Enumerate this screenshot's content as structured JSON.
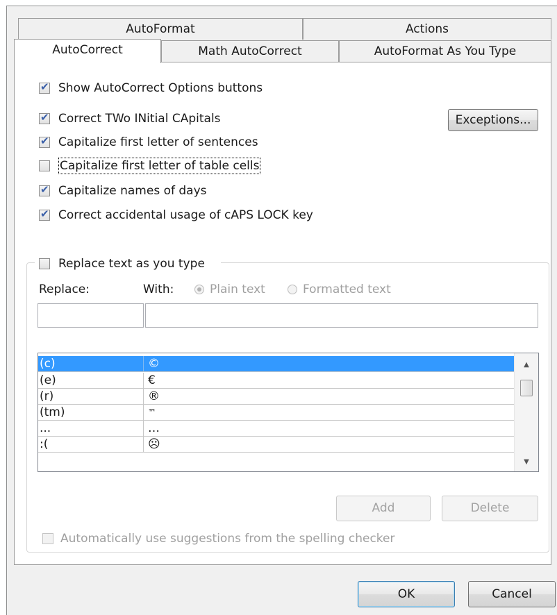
{
  "tabs_back": [
    "AutoFormat",
    "Actions"
  ],
  "tabs_front": [
    "AutoCorrect",
    "Math AutoCorrect",
    "AutoFormat As You Type"
  ],
  "options": {
    "show_buttons": {
      "label": "Show AutoCorrect Options buttons",
      "checked": true
    },
    "two_initial": {
      "label": "Correct TWo INitial CApitals",
      "checked": true
    },
    "first_letter_sentences": {
      "label": "Capitalize first letter of sentences",
      "checked": true
    },
    "first_letter_cells": {
      "label": "Capitalize first letter of table cells",
      "checked": false
    },
    "names_of_days": {
      "label": "Capitalize names of days",
      "checked": true
    },
    "caps_lock": {
      "label": "Correct accidental usage of cAPS LOCK key",
      "checked": true
    }
  },
  "exceptions_button": "Exceptions...",
  "replace_group": {
    "checkbox_label": "Replace text as you type",
    "checked": false,
    "replace_label": "Replace:",
    "with_label": "With:",
    "plain_text": "Plain text",
    "formatted_text": "Formatted text",
    "replace_value": "",
    "with_value": ""
  },
  "entries": [
    {
      "replace": "(c)",
      "with": "©",
      "selected": true
    },
    {
      "replace": "(e)",
      "with": "€",
      "selected": false
    },
    {
      "replace": "(r)",
      "with": "®",
      "selected": false
    },
    {
      "replace": "(tm)",
      "with": "™",
      "selected": false
    },
    {
      "replace": "...",
      "with": "…",
      "selected": false
    },
    {
      "replace": ":(",
      "with": "☹",
      "selected": false
    }
  ],
  "add_button": "Add",
  "delete_button": "Delete",
  "suggestions": {
    "label": "Automatically use suggestions from the spelling checker",
    "checked": false
  },
  "ok_button": "OK",
  "cancel_button": "Cancel",
  "icons": {
    "scroll_up": "scroll-up-arrow-icon",
    "scroll_down": "scroll-down-arrow-icon",
    "check": "checkmark-icon"
  }
}
